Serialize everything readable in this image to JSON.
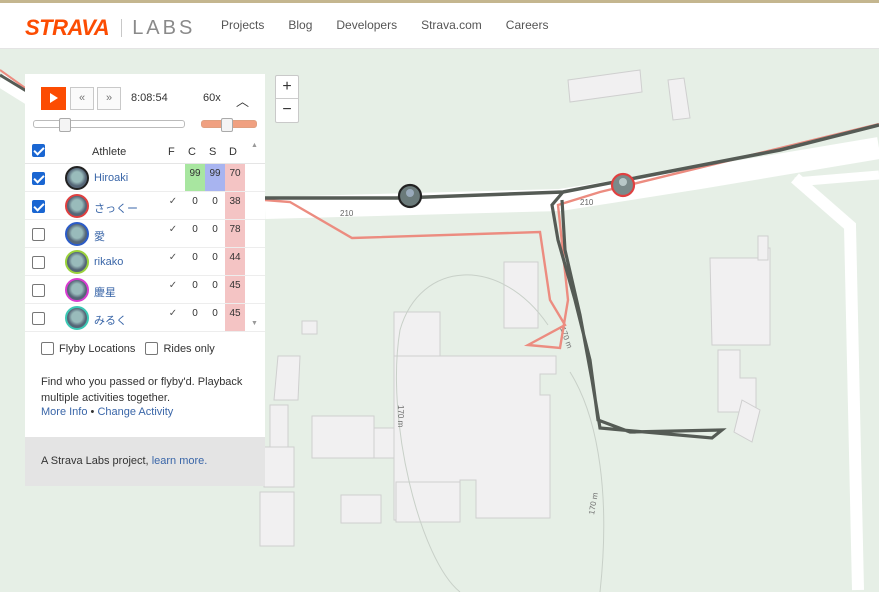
{
  "header": {
    "brand": "STRAVA",
    "sub_brand": "LABS",
    "nav": [
      "Projects",
      "Blog",
      "Developers",
      "Strava.com",
      "Careers"
    ]
  },
  "playback": {
    "time": "8:08:54",
    "speed": "60x",
    "play_icon": "play-icon",
    "back_icon": "rewind-icon",
    "forward_icon": "fast-forward-icon",
    "collapse_icon": "chevron-up-icon"
  },
  "table": {
    "columns": [
      "Athlete",
      "F",
      "C",
      "S",
      "D"
    ],
    "rows": [
      {
        "name": "Hiroaki",
        "checked": true,
        "f": "",
        "c": "99",
        "s": "99",
        "d": "70",
        "ring": "#222222"
      },
      {
        "name": "さっくー",
        "checked": true,
        "f": "✓",
        "c": "0",
        "s": "0",
        "d": "38",
        "ring": "#e04040"
      },
      {
        "name": "愛",
        "checked": false,
        "f": "✓",
        "c": "0",
        "s": "0",
        "d": "78",
        "ring": "#2c5cc8"
      },
      {
        "name": "rikako",
        "checked": false,
        "f": "✓",
        "c": "0",
        "s": "0",
        "d": "44",
        "ring": "#9bd23c"
      },
      {
        "name": "慶星",
        "checked": false,
        "f": "✓",
        "c": "0",
        "s": "0",
        "d": "45",
        "ring": "#d83cd0"
      },
      {
        "name": "みるく",
        "checked": false,
        "f": "✓",
        "c": "0",
        "s": "0",
        "d": "45",
        "ring": "#3cc8b4"
      }
    ]
  },
  "options": {
    "flyby_locations": "Flyby Locations",
    "rides_only": "Rides only"
  },
  "description": "Find who you passed or flyby'd. Playback multiple activities together.",
  "links": {
    "more_info": "More Info",
    "separator": "•",
    "change_activity": "Change Activity"
  },
  "footer": {
    "text": "A Strava Labs project,",
    "link": "learn more."
  },
  "map": {
    "road_label_1": "210",
    "road_label_2": "210",
    "contour_1": "170 m",
    "contour_2": "170 m",
    "contour_3": "170 m",
    "zoom_in": "+",
    "zoom_out": "−"
  },
  "colors": {
    "brand": "#fc4c02",
    "track_dark": "#555b55",
    "track_red": "#ec8c80",
    "col_c": "#a8e6a0",
    "col_s": "#a8b4f0",
    "col_d": "#f4c4c4"
  }
}
